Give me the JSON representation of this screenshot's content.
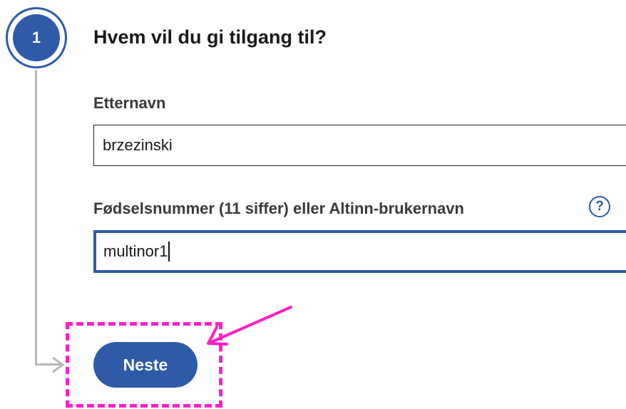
{
  "step": {
    "number": "1",
    "title": "Hvem vil du gi tilgang til?"
  },
  "form": {
    "lastname_label": "Etternavn",
    "lastname_value": "brzezinski",
    "id_label": "Fødselsnummer (11 siffer) eller Altinn-brukernavn",
    "id_value": "multinor1",
    "help_symbol": "?"
  },
  "actions": {
    "next_label": "Neste"
  },
  "colors": {
    "primary": "#2e5aa8",
    "connector": "#b8b8b8",
    "annotation": "#ff1fc8"
  },
  "icons": {
    "help": "help-icon",
    "connector_arrow": "arrow-right-icon",
    "annotation_arrow": "annotation-arrow-icon"
  }
}
